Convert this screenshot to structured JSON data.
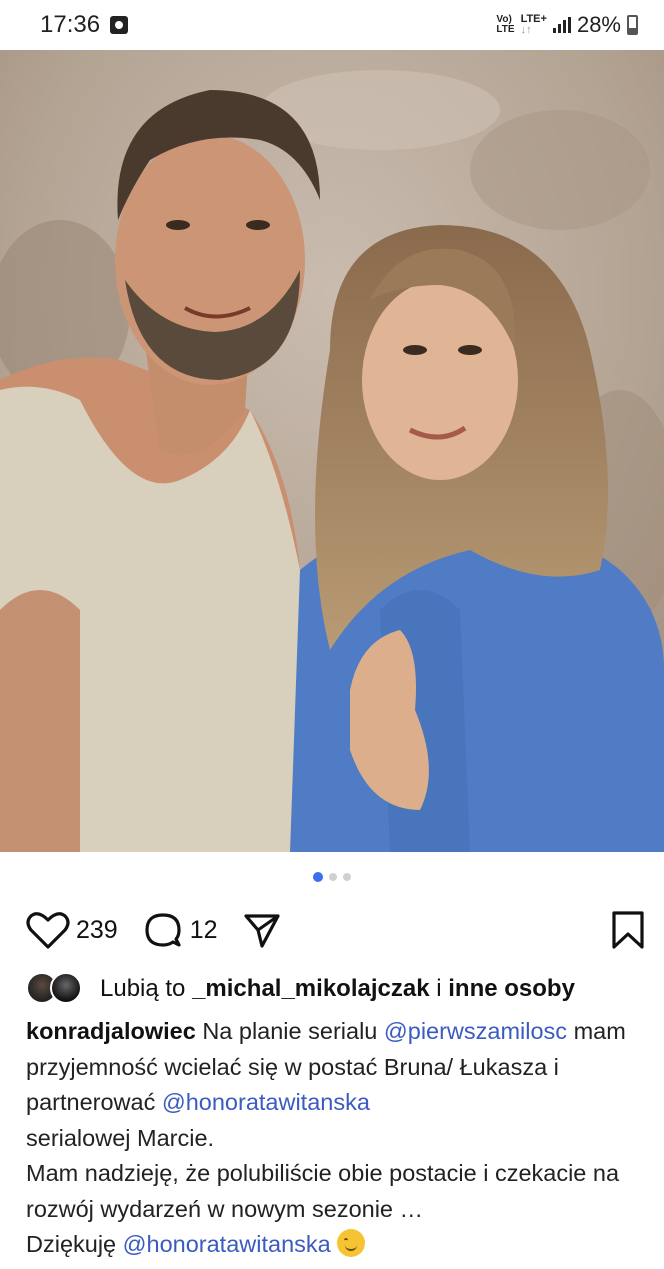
{
  "status_bar": {
    "time": "17:36",
    "network_top": "Vo)",
    "network_bottom": "LTE",
    "lte_top": "LTE+",
    "lte_bottom": "↓↑",
    "battery": "28%"
  },
  "post": {
    "carousel": {
      "current": 1,
      "total": 3
    },
    "likes_count": "239",
    "comments_count": "12",
    "liked_by": {
      "prefix": "Lubią to",
      "user": "_michal_mikolajczak",
      "connector": "i",
      "suffix": "inne osoby"
    },
    "caption": {
      "author": "konradjalowiec",
      "text1": "Na planie serialu",
      "mention1": "@pierwszamilosc",
      "text2": "mam przyjemność wcielać się w postać Bruna/ Łukasza i partnerować",
      "mention2": "@honoratawitanska",
      "text3": "serialowej Marcie.",
      "text4": "Mam nadzieję, że polubiliście obie postacie i czekacie na rozwój wydarzeń w nowym sezonie …",
      "text5": "Dziękuję",
      "mention3": "@honoratawitanska"
    }
  },
  "icons": [
    "heart-icon",
    "comment-icon",
    "share-icon",
    "bookmark-icon",
    "signal-icon",
    "battery-icon",
    "smile-emoji-icon"
  ],
  "colors": {
    "mention": "#3b5bc0",
    "active_dot": "#3b6ef0",
    "shirt_blue": "#4f7cc4"
  }
}
